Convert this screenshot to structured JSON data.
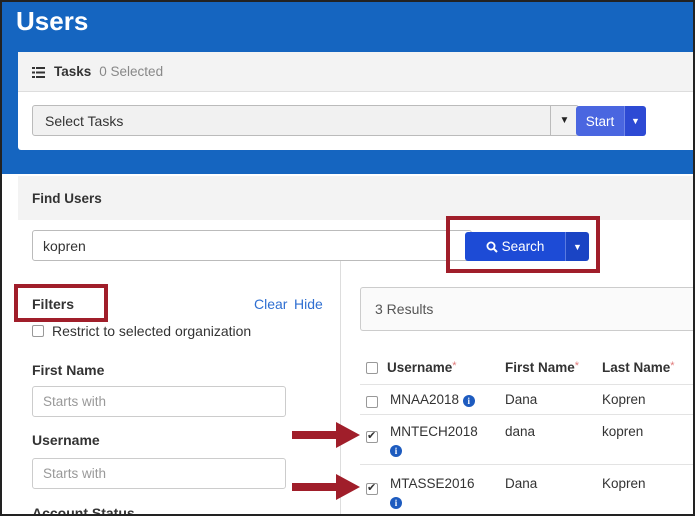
{
  "page": {
    "title": "Users"
  },
  "tasks": {
    "label": "Tasks",
    "selected_count": "0 Selected",
    "select_placeholder": "Select Tasks",
    "start_label": "Start"
  },
  "find_users": {
    "heading": "Find Users",
    "search_value": "kopren",
    "search_label": "Search"
  },
  "filters": {
    "label": "Filters",
    "clear_label": "Clear",
    "hide_label": "Hide",
    "restrict_label": "Restrict to selected organization",
    "first_name_label": "First Name",
    "first_name_placeholder": "Starts with",
    "username_label": "Username",
    "username_placeholder": "Starts with",
    "account_status_label": "Account Status"
  },
  "results": {
    "count_text": "3 Results",
    "columns": {
      "username": "Username",
      "first_name": "First Name",
      "last_name": "Last Name",
      "required_mark": "*"
    },
    "rows": [
      {
        "username": "MNAA2018",
        "first_name": "Dana",
        "last_name": "Kopren",
        "checked": false
      },
      {
        "username": "MNTECH2018",
        "first_name": "dana",
        "last_name": "kopren",
        "checked": true
      },
      {
        "username": "MTASSE2016",
        "first_name": "Dana",
        "last_name": "Kopren",
        "checked": true
      }
    ]
  },
  "colors": {
    "header_blue": "#1565c0",
    "button_blue": "#1d4bd6",
    "start_blue": "#4a66e0",
    "highlight_red": "#a01e2a",
    "link_blue": "#2f6fd1"
  },
  "icons": {
    "tasks": "list-icon",
    "search": "magnifier-icon",
    "info": "info-circle-icon",
    "annotation": "red-arrow-icon"
  }
}
